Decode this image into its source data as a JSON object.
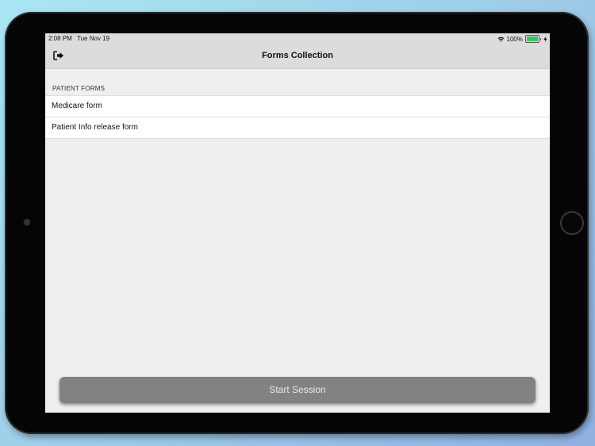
{
  "status_bar": {
    "time": "2:08 PM",
    "date": "Tue Nov 19",
    "battery_text": "100%",
    "battery_level": 1.0,
    "wifi_icon": "wifi-icon",
    "charging_icon": "bolt-icon"
  },
  "nav": {
    "title": "Forms Collection",
    "left_icon": "logout-icon"
  },
  "section": {
    "header": "PATIENT FORMS",
    "items": [
      {
        "label": "Medicare form"
      },
      {
        "label": "Patient Info release form"
      }
    ]
  },
  "footer": {
    "start_label": "Start Session"
  },
  "colors": {
    "battery_green": "#34c759",
    "button_gray": "#828282",
    "screen_bg": "#efefef",
    "bar_bg": "#dcdcdc"
  }
}
